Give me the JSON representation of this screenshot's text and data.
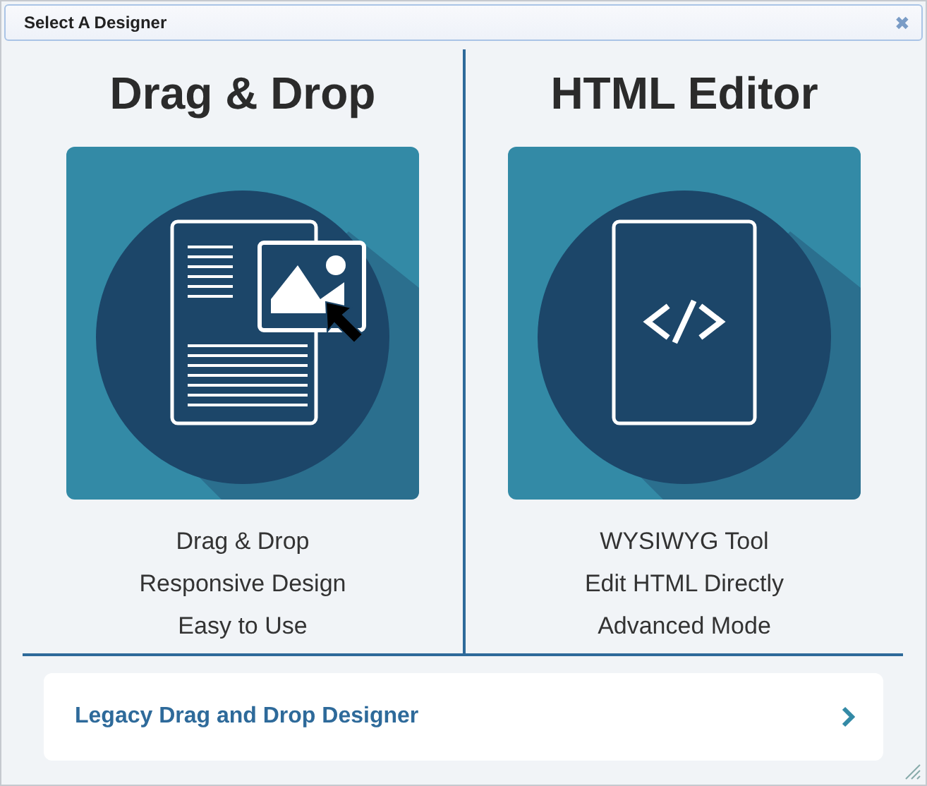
{
  "window": {
    "title": "Select A Designer",
    "close": "✖"
  },
  "designers": [
    {
      "title": "Drag & Drop",
      "kind": "drag-drop",
      "features": [
        "Drag & Drop",
        "Responsive Design",
        "Easy to Use"
      ]
    },
    {
      "title": "HTML Editor",
      "kind": "html",
      "features": [
        "WYSIWYG Tool",
        "Edit HTML Directly",
        "Advanced Mode"
      ]
    }
  ],
  "legacy": {
    "label": "Legacy Drag and Drop Designer"
  }
}
